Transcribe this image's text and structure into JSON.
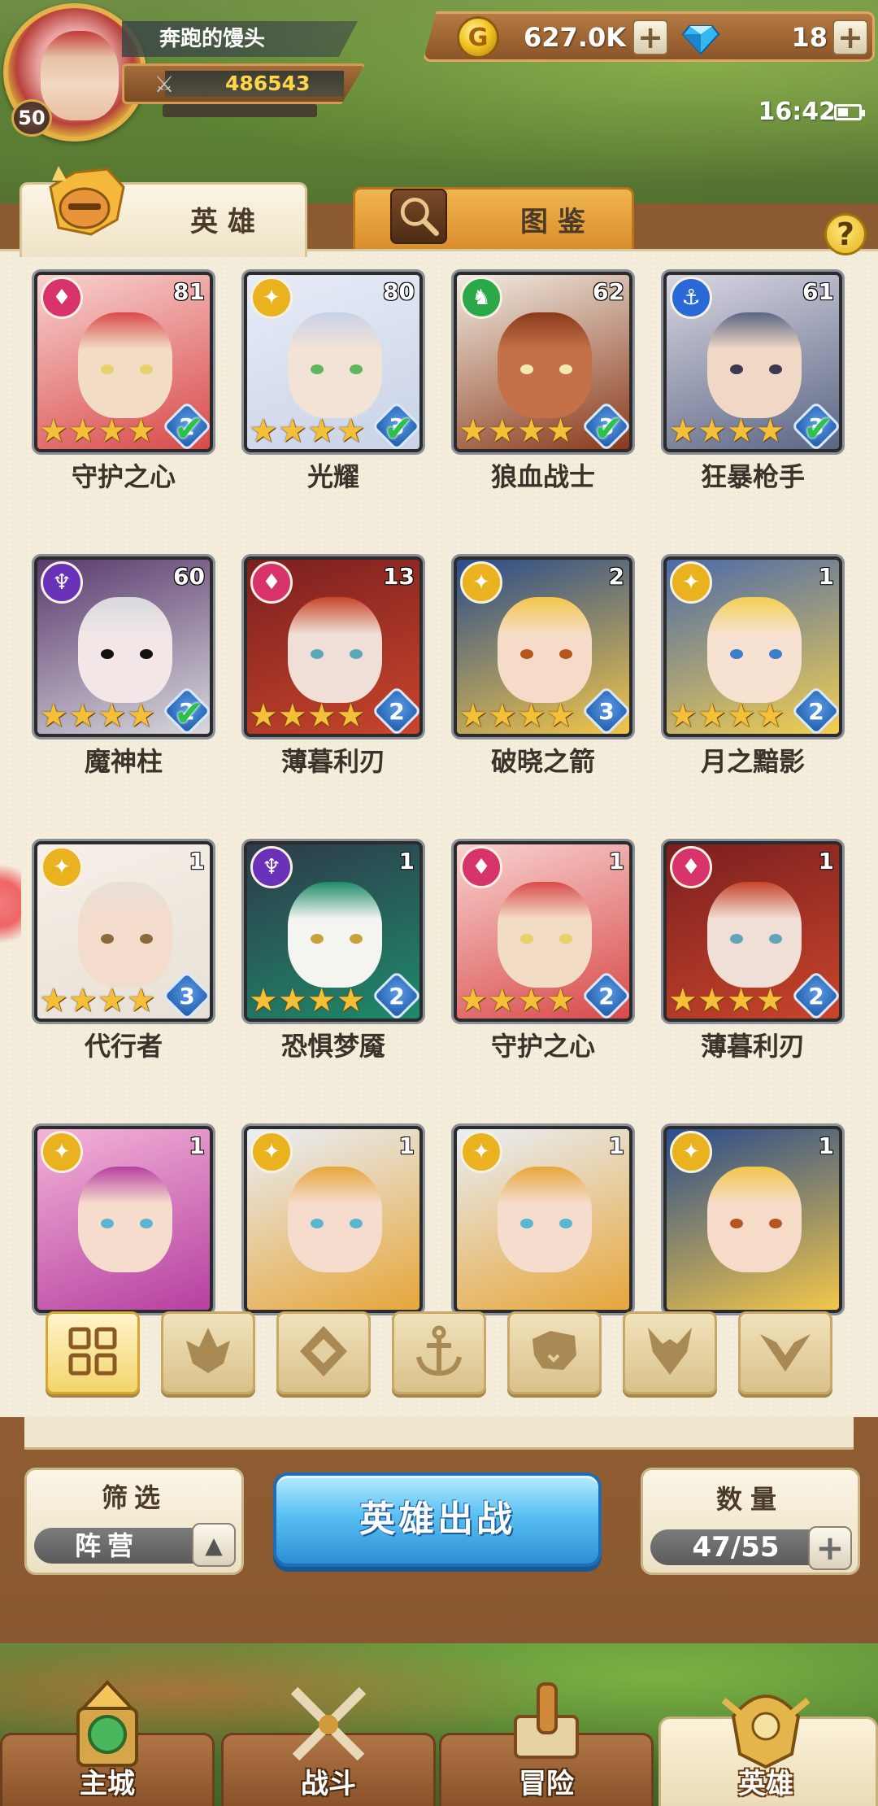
{
  "player": {
    "name": "奔跑的馒头",
    "level": "50",
    "power": "486543"
  },
  "currency": {
    "gold": "627.0K",
    "gems": "18"
  },
  "status": {
    "time": "16:42"
  },
  "tabs": {
    "hero": "英雄",
    "codex": "图鉴"
  },
  "heroes": [
    {
      "name": "守护之心",
      "level": "81",
      "rank": "2",
      "checked": true,
      "faction": "pink",
      "palette": [
        "#f8d2cf",
        "#d84a4a",
        "#f3dcc6",
        "#e8d06a"
      ]
    },
    {
      "name": "光耀",
      "level": "80",
      "rank": "3",
      "checked": true,
      "faction": "gold",
      "palette": [
        "#e7ecf6",
        "#c9d2e8",
        "#f3e2d6",
        "#5db85d"
      ]
    },
    {
      "name": "狼血战士",
      "level": "62",
      "rank": "3",
      "checked": true,
      "faction": "green",
      "palette": [
        "#f2ece2",
        "#8a3a1c",
        "#c47048",
        "#f5e9b0"
      ]
    },
    {
      "name": "狂暴枪手",
      "level": "61",
      "rank": "3",
      "checked": true,
      "faction": "blue",
      "palette": [
        "#d8d6e2",
        "#5b6684",
        "#f1d8c6",
        "#3a3a52"
      ]
    },
    {
      "name": "魔神柱",
      "level": "60",
      "rank": "2",
      "checked": true,
      "faction": "purple",
      "palette": [
        "#5a3a6e",
        "#d8d8dc",
        "#f2e6e6",
        "#111111"
      ]
    },
    {
      "name": "薄暮利刃",
      "level": "13",
      "rank": "2",
      "checked": false,
      "faction": "pink",
      "palette": [
        "#7b1f1f",
        "#c8452b",
        "#f0dfd6",
        "#5fa6b8"
      ]
    },
    {
      "name": "破晓之箭",
      "level": "2",
      "rank": "3",
      "checked": false,
      "faction": "gold",
      "palette": [
        "#2a4c8a",
        "#f2c64a",
        "#f6dcc8",
        "#b8541f"
      ]
    },
    {
      "name": "月之黯影",
      "level": "1",
      "rank": "2",
      "checked": false,
      "faction": "gold",
      "palette": [
        "#4c6aa8",
        "#f2cf52",
        "#f7e2d2",
        "#3d7ec8"
      ]
    },
    {
      "name": "代行者",
      "level": "1",
      "rank": "3",
      "checked": false,
      "faction": "gold",
      "palette": [
        "#f6f0e8",
        "#e8e0d6",
        "#f4dccd",
        "#8a6a3a"
      ]
    },
    {
      "name": "恐惧梦魇",
      "level": "1",
      "rank": "2",
      "checked": false,
      "faction": "purple",
      "palette": [
        "#2e3a4a",
        "#1e8a6a",
        "#f4f4f0",
        "#c8a23a"
      ]
    },
    {
      "name": "守护之心",
      "level": "1",
      "rank": "2",
      "checked": false,
      "faction": "pink",
      "palette": [
        "#f8d2cf",
        "#d84a4a",
        "#f3dcc6",
        "#e8d06a"
      ]
    },
    {
      "name": "薄暮利刃",
      "level": "1",
      "rank": "2",
      "checked": false,
      "faction": "pink",
      "palette": [
        "#7b1f1f",
        "#c8452b",
        "#f0dfd6",
        "#5fa6b8"
      ]
    },
    {
      "name": "",
      "level": "1",
      "rank": "",
      "checked": false,
      "faction": "gold",
      "palette": [
        "#f3b4d8",
        "#b63fa0",
        "#f6dccd",
        "#58b6d4"
      ]
    },
    {
      "name": "",
      "level": "1",
      "rank": "",
      "checked": false,
      "faction": "gold",
      "palette": [
        "#e9eef6",
        "#e6a63a",
        "#f6dccd",
        "#58b6d4"
      ]
    },
    {
      "name": "",
      "level": "1",
      "rank": "",
      "checked": false,
      "faction": "gold",
      "palette": [
        "#e9eef6",
        "#e6a63a",
        "#f6dccd",
        "#58b6d4"
      ]
    },
    {
      "name": "",
      "level": "1",
      "rank": "",
      "checked": false,
      "faction": "gold",
      "palette": [
        "#2a4c8a",
        "#f2c64a",
        "#f6dcc8",
        "#b8541f"
      ]
    }
  ],
  "faction_colors": {
    "pink": "#d8336a",
    "gold": "#e9b21e",
    "green": "#2aa84a",
    "blue": "#2a6ad8",
    "purple": "#6a32b8"
  },
  "filters": [
    {
      "id": "all",
      "icon": "grid-icon",
      "active": true
    },
    {
      "id": "pink",
      "icon": "flame-crest-icon"
    },
    {
      "id": "gold-diamond",
      "icon": "diamond-crest-icon"
    },
    {
      "id": "anchor",
      "icon": "anchor-icon"
    },
    {
      "id": "beast",
      "icon": "beast-head-icon"
    },
    {
      "id": "demon",
      "icon": "demon-horns-icon"
    },
    {
      "id": "light",
      "icon": "wings-icon"
    }
  ],
  "controls": {
    "filter_title": "筛选",
    "filter_value": "阵营",
    "deploy": "英雄出战",
    "count_title": "数量",
    "count_value": "47/55"
  },
  "nav": [
    {
      "label": "主城",
      "icon": "castle-icon"
    },
    {
      "label": "战斗",
      "icon": "crossed-swords-icon"
    },
    {
      "label": "冒险",
      "icon": "scroll-map-icon"
    },
    {
      "label": "英雄",
      "icon": "hero-helmet-icon",
      "active": true
    }
  ]
}
